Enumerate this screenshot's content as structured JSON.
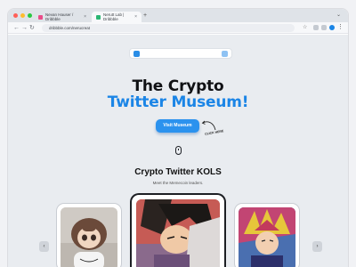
{
  "browser": {
    "tabs": [
      {
        "label": "Nevan Hauser / Dribbble"
      },
      {
        "label": "Nerutt Lab | Dribbble"
      }
    ],
    "url": "dribbble.com/nerucreat"
  },
  "hero": {
    "title_line1": "The Crypto",
    "title_line2": "Twitter Museum!",
    "cta_label": "Visit Museum",
    "cta_note": "CLICK HERE"
  },
  "kols": {
    "heading": "Crypto Twitter KOLS",
    "subheading": "Meet the Memecoin leaders."
  },
  "colors": {
    "accent": "#1b85e6",
    "button": "#2b92ee",
    "page_bg": "#e9ecf0"
  },
  "icons": [
    "search-logo-icon",
    "twitter-icon",
    "mouse-scroll-icon",
    "chevron-left-icon",
    "chevron-right-icon"
  ]
}
